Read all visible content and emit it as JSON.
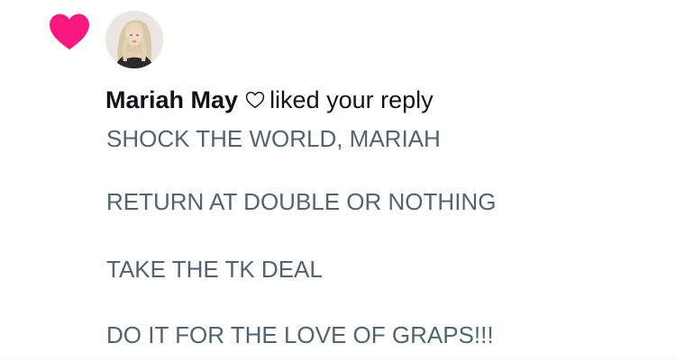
{
  "notification": {
    "icon": "heart-icon",
    "icon_color": "#f91880",
    "user_name": "Mariah May",
    "name_emoji": "♡",
    "action_text": "liked your reply",
    "reply_lines": [
      "SHOCK THE WORLD, MARIAH",
      "RETURN AT DOUBLE OR NOTHING",
      "TAKE THE TK DEAL",
      "DO IT FOR THE LOVE OF GRAPS!!!"
    ]
  },
  "colors": {
    "primary_text": "#0f1419",
    "secondary_text": "#536471",
    "like_pink": "#f91880"
  }
}
